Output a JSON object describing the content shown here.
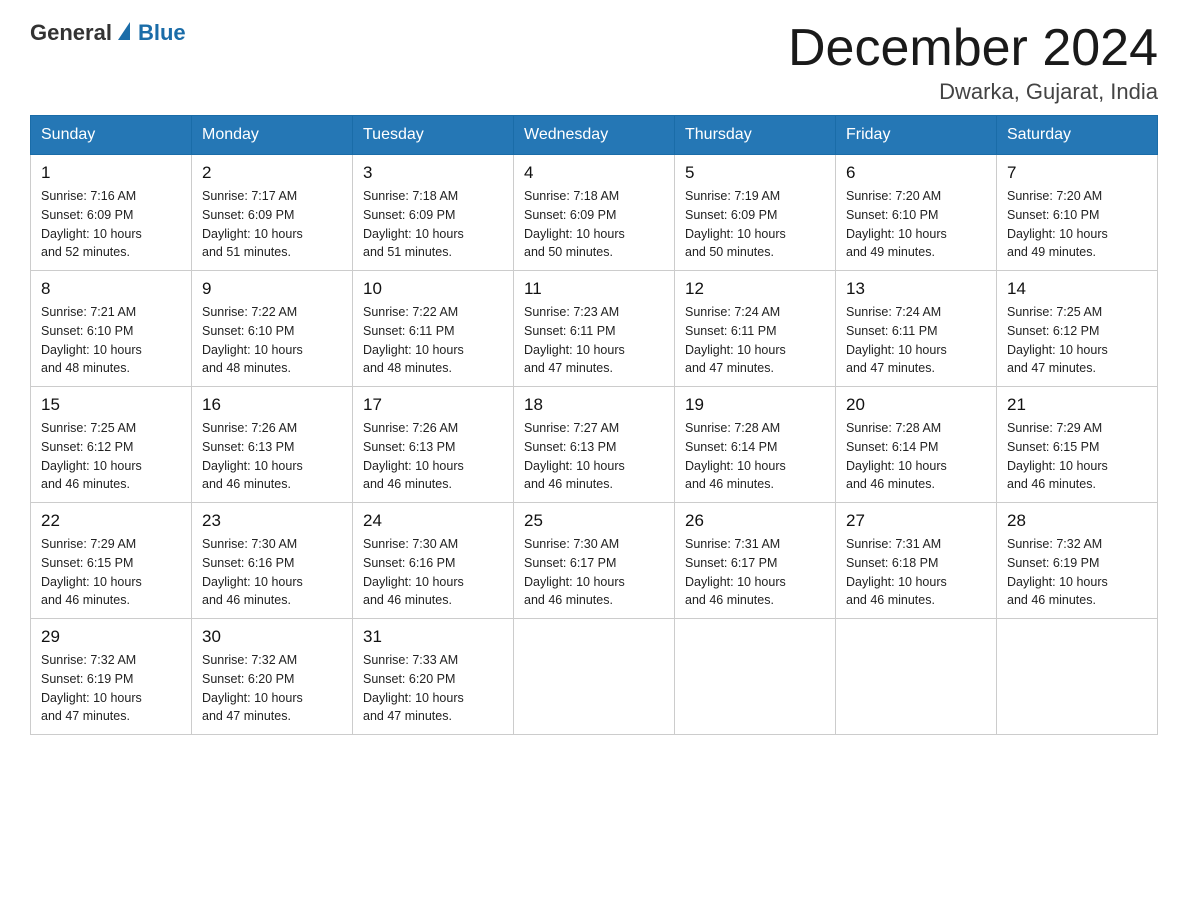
{
  "header": {
    "logo": {
      "general": "General",
      "blue": "Blue"
    },
    "month": "December 2024",
    "location": "Dwarka, Gujarat, India"
  },
  "days_of_week": [
    "Sunday",
    "Monday",
    "Tuesday",
    "Wednesday",
    "Thursday",
    "Friday",
    "Saturday"
  ],
  "weeks": [
    [
      {
        "day": "1",
        "sunrise": "7:16 AM",
        "sunset": "6:09 PM",
        "daylight": "10 hours and 52 minutes."
      },
      {
        "day": "2",
        "sunrise": "7:17 AM",
        "sunset": "6:09 PM",
        "daylight": "10 hours and 51 minutes."
      },
      {
        "day": "3",
        "sunrise": "7:18 AM",
        "sunset": "6:09 PM",
        "daylight": "10 hours and 51 minutes."
      },
      {
        "day": "4",
        "sunrise": "7:18 AM",
        "sunset": "6:09 PM",
        "daylight": "10 hours and 50 minutes."
      },
      {
        "day": "5",
        "sunrise": "7:19 AM",
        "sunset": "6:09 PM",
        "daylight": "10 hours and 50 minutes."
      },
      {
        "day": "6",
        "sunrise": "7:20 AM",
        "sunset": "6:10 PM",
        "daylight": "10 hours and 49 minutes."
      },
      {
        "day": "7",
        "sunrise": "7:20 AM",
        "sunset": "6:10 PM",
        "daylight": "10 hours and 49 minutes."
      }
    ],
    [
      {
        "day": "8",
        "sunrise": "7:21 AM",
        "sunset": "6:10 PM",
        "daylight": "10 hours and 48 minutes."
      },
      {
        "day": "9",
        "sunrise": "7:22 AM",
        "sunset": "6:10 PM",
        "daylight": "10 hours and 48 minutes."
      },
      {
        "day": "10",
        "sunrise": "7:22 AM",
        "sunset": "6:11 PM",
        "daylight": "10 hours and 48 minutes."
      },
      {
        "day": "11",
        "sunrise": "7:23 AM",
        "sunset": "6:11 PM",
        "daylight": "10 hours and 47 minutes."
      },
      {
        "day": "12",
        "sunrise": "7:24 AM",
        "sunset": "6:11 PM",
        "daylight": "10 hours and 47 minutes."
      },
      {
        "day": "13",
        "sunrise": "7:24 AM",
        "sunset": "6:11 PM",
        "daylight": "10 hours and 47 minutes."
      },
      {
        "day": "14",
        "sunrise": "7:25 AM",
        "sunset": "6:12 PM",
        "daylight": "10 hours and 47 minutes."
      }
    ],
    [
      {
        "day": "15",
        "sunrise": "7:25 AM",
        "sunset": "6:12 PM",
        "daylight": "10 hours and 46 minutes."
      },
      {
        "day": "16",
        "sunrise": "7:26 AM",
        "sunset": "6:13 PM",
        "daylight": "10 hours and 46 minutes."
      },
      {
        "day": "17",
        "sunrise": "7:26 AM",
        "sunset": "6:13 PM",
        "daylight": "10 hours and 46 minutes."
      },
      {
        "day": "18",
        "sunrise": "7:27 AM",
        "sunset": "6:13 PM",
        "daylight": "10 hours and 46 minutes."
      },
      {
        "day": "19",
        "sunrise": "7:28 AM",
        "sunset": "6:14 PM",
        "daylight": "10 hours and 46 minutes."
      },
      {
        "day": "20",
        "sunrise": "7:28 AM",
        "sunset": "6:14 PM",
        "daylight": "10 hours and 46 minutes."
      },
      {
        "day": "21",
        "sunrise": "7:29 AM",
        "sunset": "6:15 PM",
        "daylight": "10 hours and 46 minutes."
      }
    ],
    [
      {
        "day": "22",
        "sunrise": "7:29 AM",
        "sunset": "6:15 PM",
        "daylight": "10 hours and 46 minutes."
      },
      {
        "day": "23",
        "sunrise": "7:30 AM",
        "sunset": "6:16 PM",
        "daylight": "10 hours and 46 minutes."
      },
      {
        "day": "24",
        "sunrise": "7:30 AM",
        "sunset": "6:16 PM",
        "daylight": "10 hours and 46 minutes."
      },
      {
        "day": "25",
        "sunrise": "7:30 AM",
        "sunset": "6:17 PM",
        "daylight": "10 hours and 46 minutes."
      },
      {
        "day": "26",
        "sunrise": "7:31 AM",
        "sunset": "6:17 PM",
        "daylight": "10 hours and 46 minutes."
      },
      {
        "day": "27",
        "sunrise": "7:31 AM",
        "sunset": "6:18 PM",
        "daylight": "10 hours and 46 minutes."
      },
      {
        "day": "28",
        "sunrise": "7:32 AM",
        "sunset": "6:19 PM",
        "daylight": "10 hours and 46 minutes."
      }
    ],
    [
      {
        "day": "29",
        "sunrise": "7:32 AM",
        "sunset": "6:19 PM",
        "daylight": "10 hours and 47 minutes."
      },
      {
        "day": "30",
        "sunrise": "7:32 AM",
        "sunset": "6:20 PM",
        "daylight": "10 hours and 47 minutes."
      },
      {
        "day": "31",
        "sunrise": "7:33 AM",
        "sunset": "6:20 PM",
        "daylight": "10 hours and 47 minutes."
      },
      null,
      null,
      null,
      null
    ]
  ],
  "labels": {
    "sunrise": "Sunrise:",
    "sunset": "Sunset:",
    "daylight": "Daylight:"
  }
}
